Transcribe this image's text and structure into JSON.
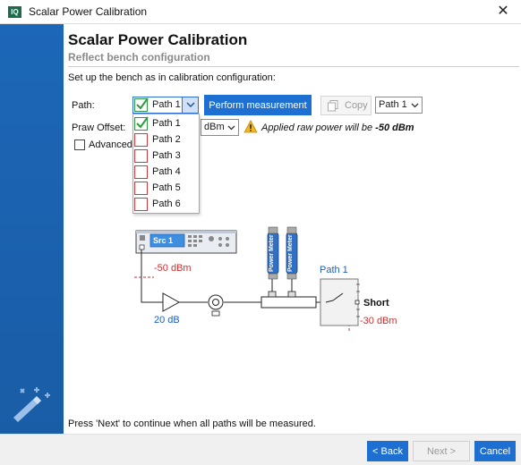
{
  "window": {
    "app_icon_text": "IQ",
    "title": "Scalar Power Calibration",
    "close_glyph": "✕"
  },
  "header": {
    "title": "Scalar Power Calibration",
    "subtitle": "Reflect bench configuration"
  },
  "instruction": "Set up the bench as in calibration configuration:",
  "controls": {
    "path_label": "Path:",
    "path_selected": "Path 1",
    "perform_button": "Perform measurement",
    "copy_button": "Copy",
    "copy_target": "Path 1",
    "praw_label": "Praw Offset:",
    "unit_selected": "dBm",
    "advanced_label": "Advanced",
    "warning_prefix": "Applied raw power will be ",
    "warning_value": "-50 dBm"
  },
  "path_options": [
    {
      "label": "Path 1",
      "checked": true
    },
    {
      "label": "Path 2",
      "checked": false
    },
    {
      "label": "Path 3",
      "checked": false
    },
    {
      "label": "Path 4",
      "checked": false
    },
    {
      "label": "Path 5",
      "checked": false
    },
    {
      "label": "Path 6",
      "checked": false
    }
  ],
  "diagram": {
    "source_label": "Src 1",
    "source_power": "-50 dBm",
    "amp_gain": "20 dB",
    "meter1_label": "Power Meter",
    "meter2_label": "Power Meter",
    "path_label": "Path 1",
    "termination_label": "Short",
    "port_power": "-30 dBm"
  },
  "footer_note": "Press 'Next' to continue when all paths will be measured.",
  "buttons": {
    "back": "< Back",
    "next": "Next >",
    "cancel": "Cancel"
  },
  "colors": {
    "accent": "#1d6fd1",
    "sidebar": "#1d67b8",
    "check_green": "#2e9a3d",
    "unchecked_red": "#d23b3b",
    "power_red": "#c83232",
    "label_blue": "#1d5fb8"
  }
}
